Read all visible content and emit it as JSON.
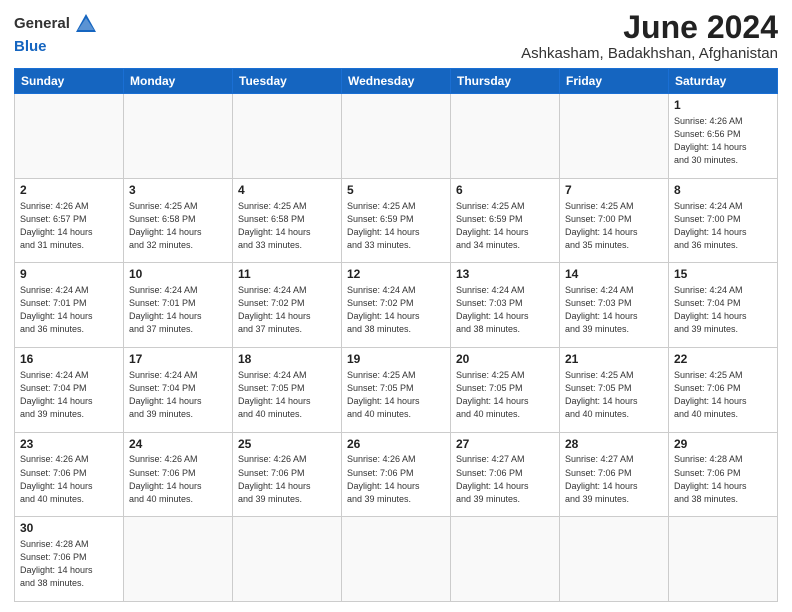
{
  "header": {
    "logo_general": "General",
    "logo_blue": "Blue",
    "title": "June 2024",
    "subtitle": "Ashkasham, Badakhshan, Afghanistan"
  },
  "weekdays": [
    "Sunday",
    "Monday",
    "Tuesday",
    "Wednesday",
    "Thursday",
    "Friday",
    "Saturday"
  ],
  "weeks": [
    [
      {
        "day": "",
        "info": ""
      },
      {
        "day": "",
        "info": ""
      },
      {
        "day": "",
        "info": ""
      },
      {
        "day": "",
        "info": ""
      },
      {
        "day": "",
        "info": ""
      },
      {
        "day": "",
        "info": ""
      },
      {
        "day": "1",
        "info": "Sunrise: 4:26 AM\nSunset: 6:56 PM\nDaylight: 14 hours\nand 30 minutes."
      }
    ],
    [
      {
        "day": "2",
        "info": "Sunrise: 4:26 AM\nSunset: 6:57 PM\nDaylight: 14 hours\nand 31 minutes."
      },
      {
        "day": "3",
        "info": "Sunrise: 4:25 AM\nSunset: 6:58 PM\nDaylight: 14 hours\nand 32 minutes."
      },
      {
        "day": "4",
        "info": "Sunrise: 4:25 AM\nSunset: 6:58 PM\nDaylight: 14 hours\nand 33 minutes."
      },
      {
        "day": "5",
        "info": "Sunrise: 4:25 AM\nSunset: 6:59 PM\nDaylight: 14 hours\nand 33 minutes."
      },
      {
        "day": "6",
        "info": "Sunrise: 4:25 AM\nSunset: 6:59 PM\nDaylight: 14 hours\nand 34 minutes."
      },
      {
        "day": "7",
        "info": "Sunrise: 4:25 AM\nSunset: 7:00 PM\nDaylight: 14 hours\nand 35 minutes."
      },
      {
        "day": "8",
        "info": "Sunrise: 4:24 AM\nSunset: 7:00 PM\nDaylight: 14 hours\nand 36 minutes."
      }
    ],
    [
      {
        "day": "9",
        "info": "Sunrise: 4:24 AM\nSunset: 7:01 PM\nDaylight: 14 hours\nand 36 minutes."
      },
      {
        "day": "10",
        "info": "Sunrise: 4:24 AM\nSunset: 7:01 PM\nDaylight: 14 hours\nand 37 minutes."
      },
      {
        "day": "11",
        "info": "Sunrise: 4:24 AM\nSunset: 7:02 PM\nDaylight: 14 hours\nand 37 minutes."
      },
      {
        "day": "12",
        "info": "Sunrise: 4:24 AM\nSunset: 7:02 PM\nDaylight: 14 hours\nand 38 minutes."
      },
      {
        "day": "13",
        "info": "Sunrise: 4:24 AM\nSunset: 7:03 PM\nDaylight: 14 hours\nand 38 minutes."
      },
      {
        "day": "14",
        "info": "Sunrise: 4:24 AM\nSunset: 7:03 PM\nDaylight: 14 hours\nand 39 minutes."
      },
      {
        "day": "15",
        "info": "Sunrise: 4:24 AM\nSunset: 7:04 PM\nDaylight: 14 hours\nand 39 minutes."
      }
    ],
    [
      {
        "day": "16",
        "info": "Sunrise: 4:24 AM\nSunset: 7:04 PM\nDaylight: 14 hours\nand 39 minutes."
      },
      {
        "day": "17",
        "info": "Sunrise: 4:24 AM\nSunset: 7:04 PM\nDaylight: 14 hours\nand 39 minutes."
      },
      {
        "day": "18",
        "info": "Sunrise: 4:24 AM\nSunset: 7:05 PM\nDaylight: 14 hours\nand 40 minutes."
      },
      {
        "day": "19",
        "info": "Sunrise: 4:25 AM\nSunset: 7:05 PM\nDaylight: 14 hours\nand 40 minutes."
      },
      {
        "day": "20",
        "info": "Sunrise: 4:25 AM\nSunset: 7:05 PM\nDaylight: 14 hours\nand 40 minutes."
      },
      {
        "day": "21",
        "info": "Sunrise: 4:25 AM\nSunset: 7:05 PM\nDaylight: 14 hours\nand 40 minutes."
      },
      {
        "day": "22",
        "info": "Sunrise: 4:25 AM\nSunset: 7:06 PM\nDaylight: 14 hours\nand 40 minutes."
      }
    ],
    [
      {
        "day": "23",
        "info": "Sunrise: 4:26 AM\nSunset: 7:06 PM\nDaylight: 14 hours\nand 40 minutes."
      },
      {
        "day": "24",
        "info": "Sunrise: 4:26 AM\nSunset: 7:06 PM\nDaylight: 14 hours\nand 40 minutes."
      },
      {
        "day": "25",
        "info": "Sunrise: 4:26 AM\nSunset: 7:06 PM\nDaylight: 14 hours\nand 39 minutes."
      },
      {
        "day": "26",
        "info": "Sunrise: 4:26 AM\nSunset: 7:06 PM\nDaylight: 14 hours\nand 39 minutes."
      },
      {
        "day": "27",
        "info": "Sunrise: 4:27 AM\nSunset: 7:06 PM\nDaylight: 14 hours\nand 39 minutes."
      },
      {
        "day": "28",
        "info": "Sunrise: 4:27 AM\nSunset: 7:06 PM\nDaylight: 14 hours\nand 39 minutes."
      },
      {
        "day": "29",
        "info": "Sunrise: 4:28 AM\nSunset: 7:06 PM\nDaylight: 14 hours\nand 38 minutes."
      }
    ],
    [
      {
        "day": "30",
        "info": "Sunrise: 4:28 AM\nSunset: 7:06 PM\nDaylight: 14 hours\nand 38 minutes."
      },
      {
        "day": "",
        "info": ""
      },
      {
        "day": "",
        "info": ""
      },
      {
        "day": "",
        "info": ""
      },
      {
        "day": "",
        "info": ""
      },
      {
        "day": "",
        "info": ""
      },
      {
        "day": "",
        "info": ""
      }
    ]
  ]
}
